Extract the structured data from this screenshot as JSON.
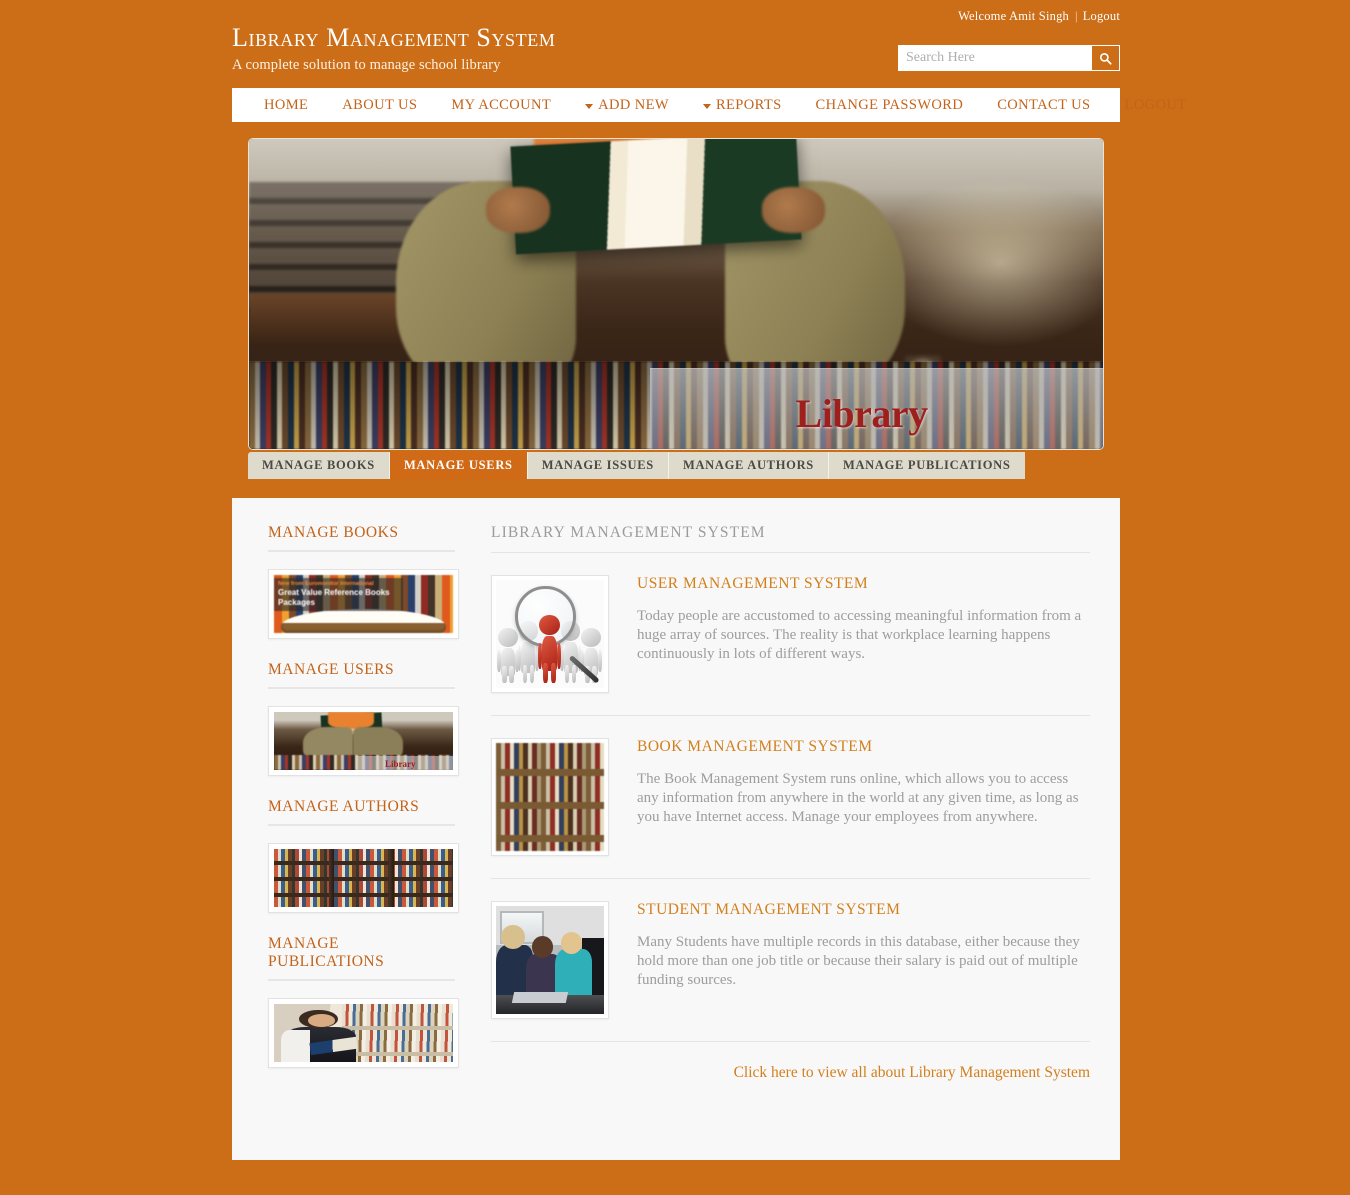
{
  "header": {
    "welcome": "Welcome Amit Singh",
    "separator": "|",
    "logout": "Logout",
    "title": "Library Management System",
    "subtitle": "A complete solution to manage school library",
    "search_placeholder": "Search Here",
    "search_value": "",
    "search_icon": "search-icon",
    "brand_color": "#cc6d17"
  },
  "nav": {
    "items": [
      {
        "label": "Home",
        "has_caret": false
      },
      {
        "label": "About Us",
        "has_caret": false
      },
      {
        "label": "My Account",
        "has_caret": false
      },
      {
        "label": "Add New",
        "has_caret": true
      },
      {
        "label": "Reports",
        "has_caret": true
      },
      {
        "label": "Change Password",
        "has_caret": false
      },
      {
        "label": "Contact Us",
        "has_caret": false
      },
      {
        "label": "Logout",
        "has_caret": false
      }
    ]
  },
  "hero": {
    "caption": "Library",
    "alt": "person reading a book in a library"
  },
  "tabs": {
    "items": [
      {
        "label": "Manage Books",
        "active": false
      },
      {
        "label": "Manage Users",
        "active": true
      },
      {
        "label": "Manage Issues",
        "active": false
      },
      {
        "label": "Manage Authors",
        "active": false
      },
      {
        "label": "Manage Publications",
        "active": false
      }
    ],
    "active_color": "#d06a16",
    "inactive_color": "#dedbcd"
  },
  "sidebar": {
    "sections": [
      {
        "heading": "Manage Books",
        "thumb_name": "reference-books-thumbnail",
        "overlay_line1": "New from Euromonitor International",
        "overlay_line2": "Great Value\nReference Books Packages"
      },
      {
        "heading": "Manage Users",
        "thumb_name": "reading-person-thumbnail",
        "thumb_caption": "Library"
      },
      {
        "heading": "Manage Authors",
        "thumb_name": "bookshelf-wall-thumbnail"
      },
      {
        "heading": "Manage Publications",
        "thumb_name": "student-browsing-thumbnail"
      }
    ]
  },
  "main": {
    "heading": "Library Management System",
    "features": [
      {
        "title": "User Management System",
        "text": "Today people are accustomed to accessing meaningful information from a huge array of sources. The reality is that workplace learning happens continuously in lots of different ways.",
        "thumb_name": "people-magnifier-image"
      },
      {
        "title": "Book Management System",
        "text": "The Book Management System runs online, which allows you to access any information from anywhere in the world at any given time, as long as you have Internet access. Manage your employees from anywhere.",
        "thumb_name": "bookshelf-image"
      },
      {
        "title": "Student Management System",
        "text": "Many Students have multiple records in this database, either because they hold more than one job title or because their salary is paid out of multiple funding sources.",
        "thumb_name": "students-computer-image"
      }
    ],
    "footer_link": "Click here to view all about Library Management System"
  },
  "colors": {
    "accent_orange": "#cc6d17",
    "heading_orange": "#c4631a",
    "link_orange": "#d2801e",
    "panel_bg": "#f8f8f8",
    "body_text": "#9d9d9d"
  }
}
